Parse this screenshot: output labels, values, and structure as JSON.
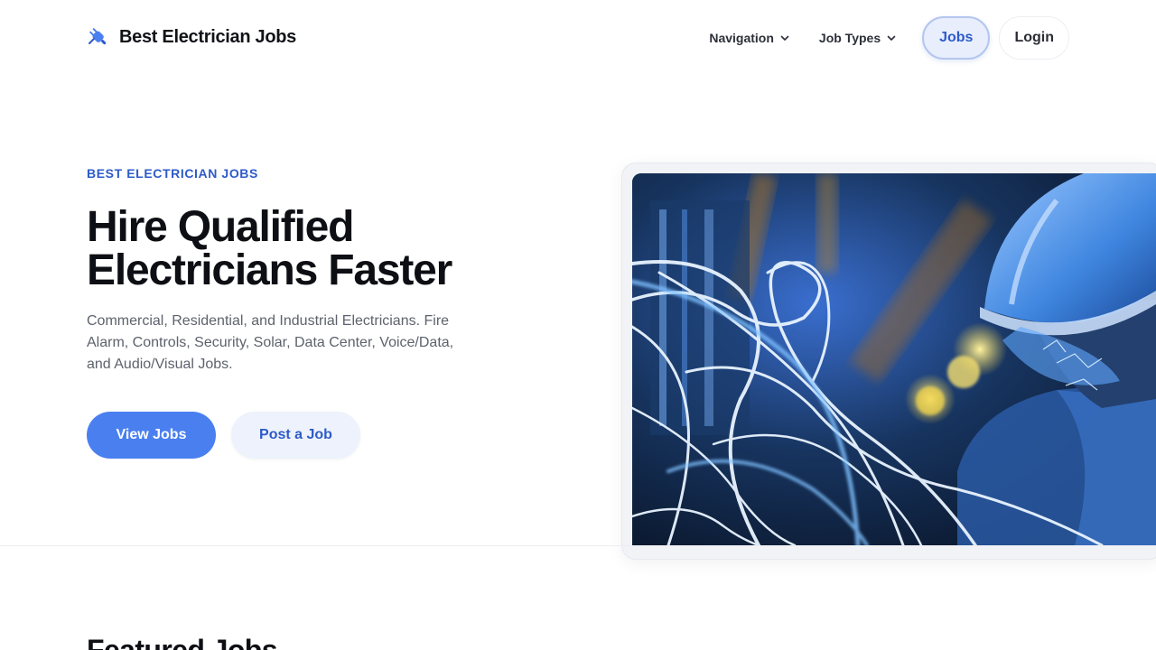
{
  "header": {
    "brand": "Best Electrician Jobs",
    "nav": {
      "navigation": "Navigation",
      "job_types": "Job Types",
      "jobs": "Jobs",
      "login": "Login"
    }
  },
  "hero": {
    "eyebrow": "BEST ELECTRICIAN JOBS",
    "title_line1": "Hire Qualified",
    "title_line2": "Electricians Faster",
    "description": "Commercial, Residential, and Industrial Electricians. Fire Alarm, Controls, Security, Solar, Data Center, Voice/Data, and Audio/Visual Jobs.",
    "primary_button": "View Jobs",
    "secondary_button": "Post a Job"
  },
  "featured": {
    "title": "Featured Jobs"
  },
  "colors": {
    "accent": "#4a7ff0",
    "accent_text": "#2e5bc9",
    "accent_soft": "#eef2fc"
  },
  "icons": {
    "logo": "electric-plug-icon",
    "dropdown": "chevron-down-icon"
  }
}
